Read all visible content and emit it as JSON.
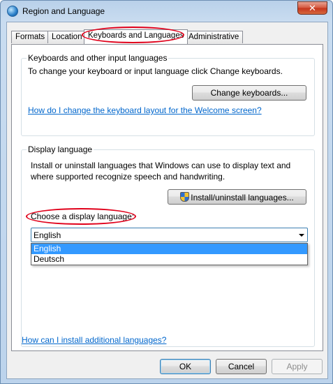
{
  "window": {
    "title": "Region and Language",
    "close_glyph": "✕"
  },
  "tabs": [
    {
      "label": "Formats"
    },
    {
      "label": "Location"
    },
    {
      "label": "Keyboards and Languages"
    },
    {
      "label": "Administrative"
    }
  ],
  "keyboards_group": {
    "title": "Keyboards and other input languages",
    "description": "To change your keyboard or input language click Change keyboards.",
    "change_button": "Change keyboards...",
    "welcome_link": "How do I change the keyboard layout for the Welcome screen?"
  },
  "display_group": {
    "title": "Display language",
    "description_line1": "Install or uninstall languages that Windows can use to display text and",
    "description_line2": "where supported recognize speech and handwriting.",
    "install_button": "Install/uninstall languages...",
    "choose_label": "Choose a display language:",
    "selected_language": "English",
    "options": [
      "English",
      "Deutsch"
    ]
  },
  "footer_link": "How can I install additional languages?",
  "buttons": {
    "ok": "OK",
    "cancel": "Cancel",
    "apply": "Apply"
  },
  "colors": {
    "highlight_ellipse": "#e0001a",
    "selection": "#3399ff",
    "link": "#0066cc"
  }
}
